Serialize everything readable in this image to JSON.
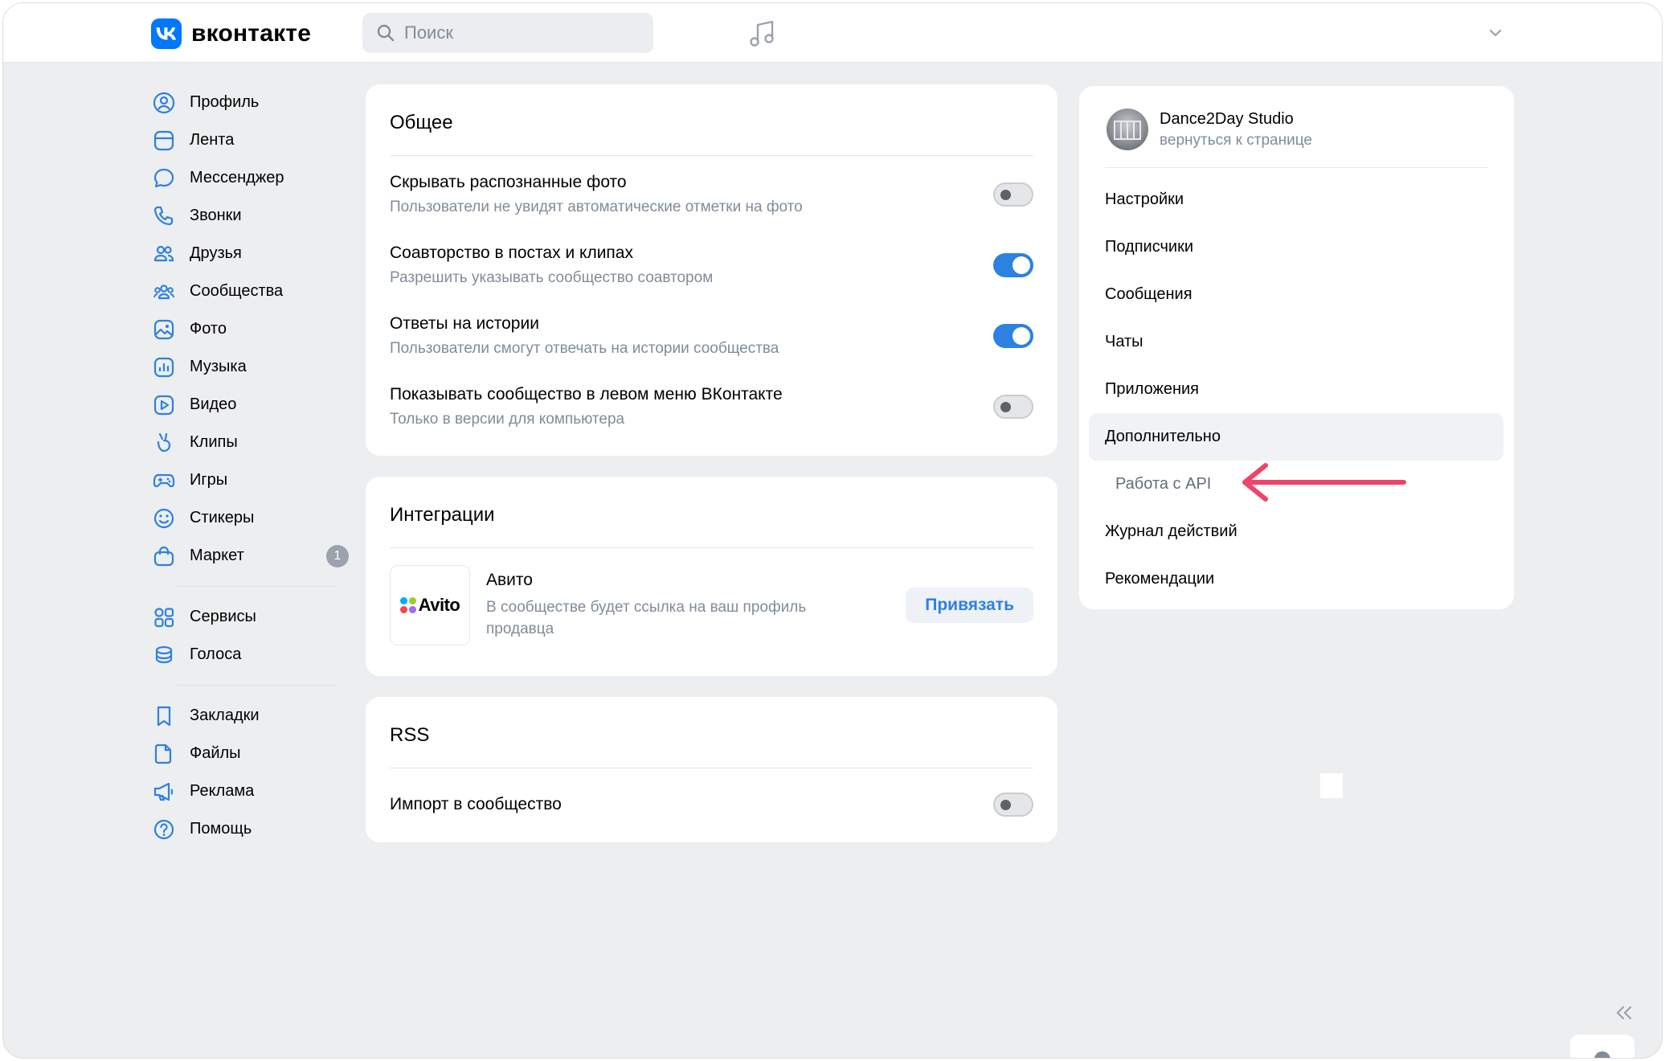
{
  "header": {
    "logo_text": "вконтакте",
    "search_placeholder": "Поиск"
  },
  "sidebar": {
    "items": [
      {
        "label": "Профиль",
        "icon": "user-circle-icon"
      },
      {
        "label": "Лента",
        "icon": "newsfeed-icon"
      },
      {
        "label": "Мессенджер",
        "icon": "message-icon"
      },
      {
        "label": "Звонки",
        "icon": "phone-icon"
      },
      {
        "label": "Друзья",
        "icon": "friends-icon"
      },
      {
        "label": "Сообщества",
        "icon": "communities-icon"
      },
      {
        "label": "Фото",
        "icon": "photo-icon"
      },
      {
        "label": "Музыка",
        "icon": "music-icon"
      },
      {
        "label": "Видео",
        "icon": "video-icon"
      },
      {
        "label": "Клипы",
        "icon": "clips-icon"
      },
      {
        "label": "Игры",
        "icon": "gamepad-icon"
      },
      {
        "label": "Стикеры",
        "icon": "smile-icon"
      },
      {
        "label": "Маркет",
        "icon": "market-bag-icon",
        "badge": "1"
      }
    ],
    "group2": [
      {
        "label": "Сервисы",
        "icon": "services-grid-icon"
      },
      {
        "label": "Голоса",
        "icon": "coins-icon"
      }
    ],
    "group3": [
      {
        "label": "Закладки",
        "icon": "bookmark-icon"
      },
      {
        "label": "Файлы",
        "icon": "file-icon"
      },
      {
        "label": "Реклама",
        "icon": "megaphone-icon"
      },
      {
        "label": "Помощь",
        "icon": "help-icon"
      }
    ]
  },
  "general": {
    "title": "Общее",
    "rows": [
      {
        "title": "Скрывать распознанные фото",
        "subtitle": "Пользователи не увидят автоматические отметки на фото",
        "enabled": false
      },
      {
        "title": "Соавторство в постах и клипах",
        "subtitle": "Разрешить указывать сообщество соавтором",
        "enabled": true
      },
      {
        "title": "Ответы на истории",
        "subtitle": "Пользователи смогут отвечать на истории сообщества",
        "enabled": true
      },
      {
        "title": "Показывать сообщество в левом меню ВКонтакте",
        "subtitle": "Только в версии для компьютера",
        "enabled": false
      }
    ]
  },
  "integrations": {
    "title": "Интеграции",
    "avito_logo_text": "Avito",
    "name": "Авито",
    "description": "В сообществе будет ссылка на ваш профиль продавца",
    "button": "Привязать"
  },
  "rss": {
    "title": "RSS",
    "row_title": "Импорт в сообщество",
    "enabled": false
  },
  "community_menu": {
    "name": "Dance2Day Studio",
    "back_link": "вернуться к странице",
    "items": [
      {
        "label": "Настройки"
      },
      {
        "label": "Подписчики"
      },
      {
        "label": "Сообщения"
      },
      {
        "label": "Чаты"
      },
      {
        "label": "Приложения"
      },
      {
        "label": "Дополнительно",
        "active": true
      },
      {
        "label": "Работа с API",
        "sub": true
      },
      {
        "label": "Журнал действий"
      },
      {
        "label": "Рекомендации"
      }
    ]
  },
  "colors": {
    "accent": "#2d81e0",
    "annotation_arrow": "#f04368"
  }
}
